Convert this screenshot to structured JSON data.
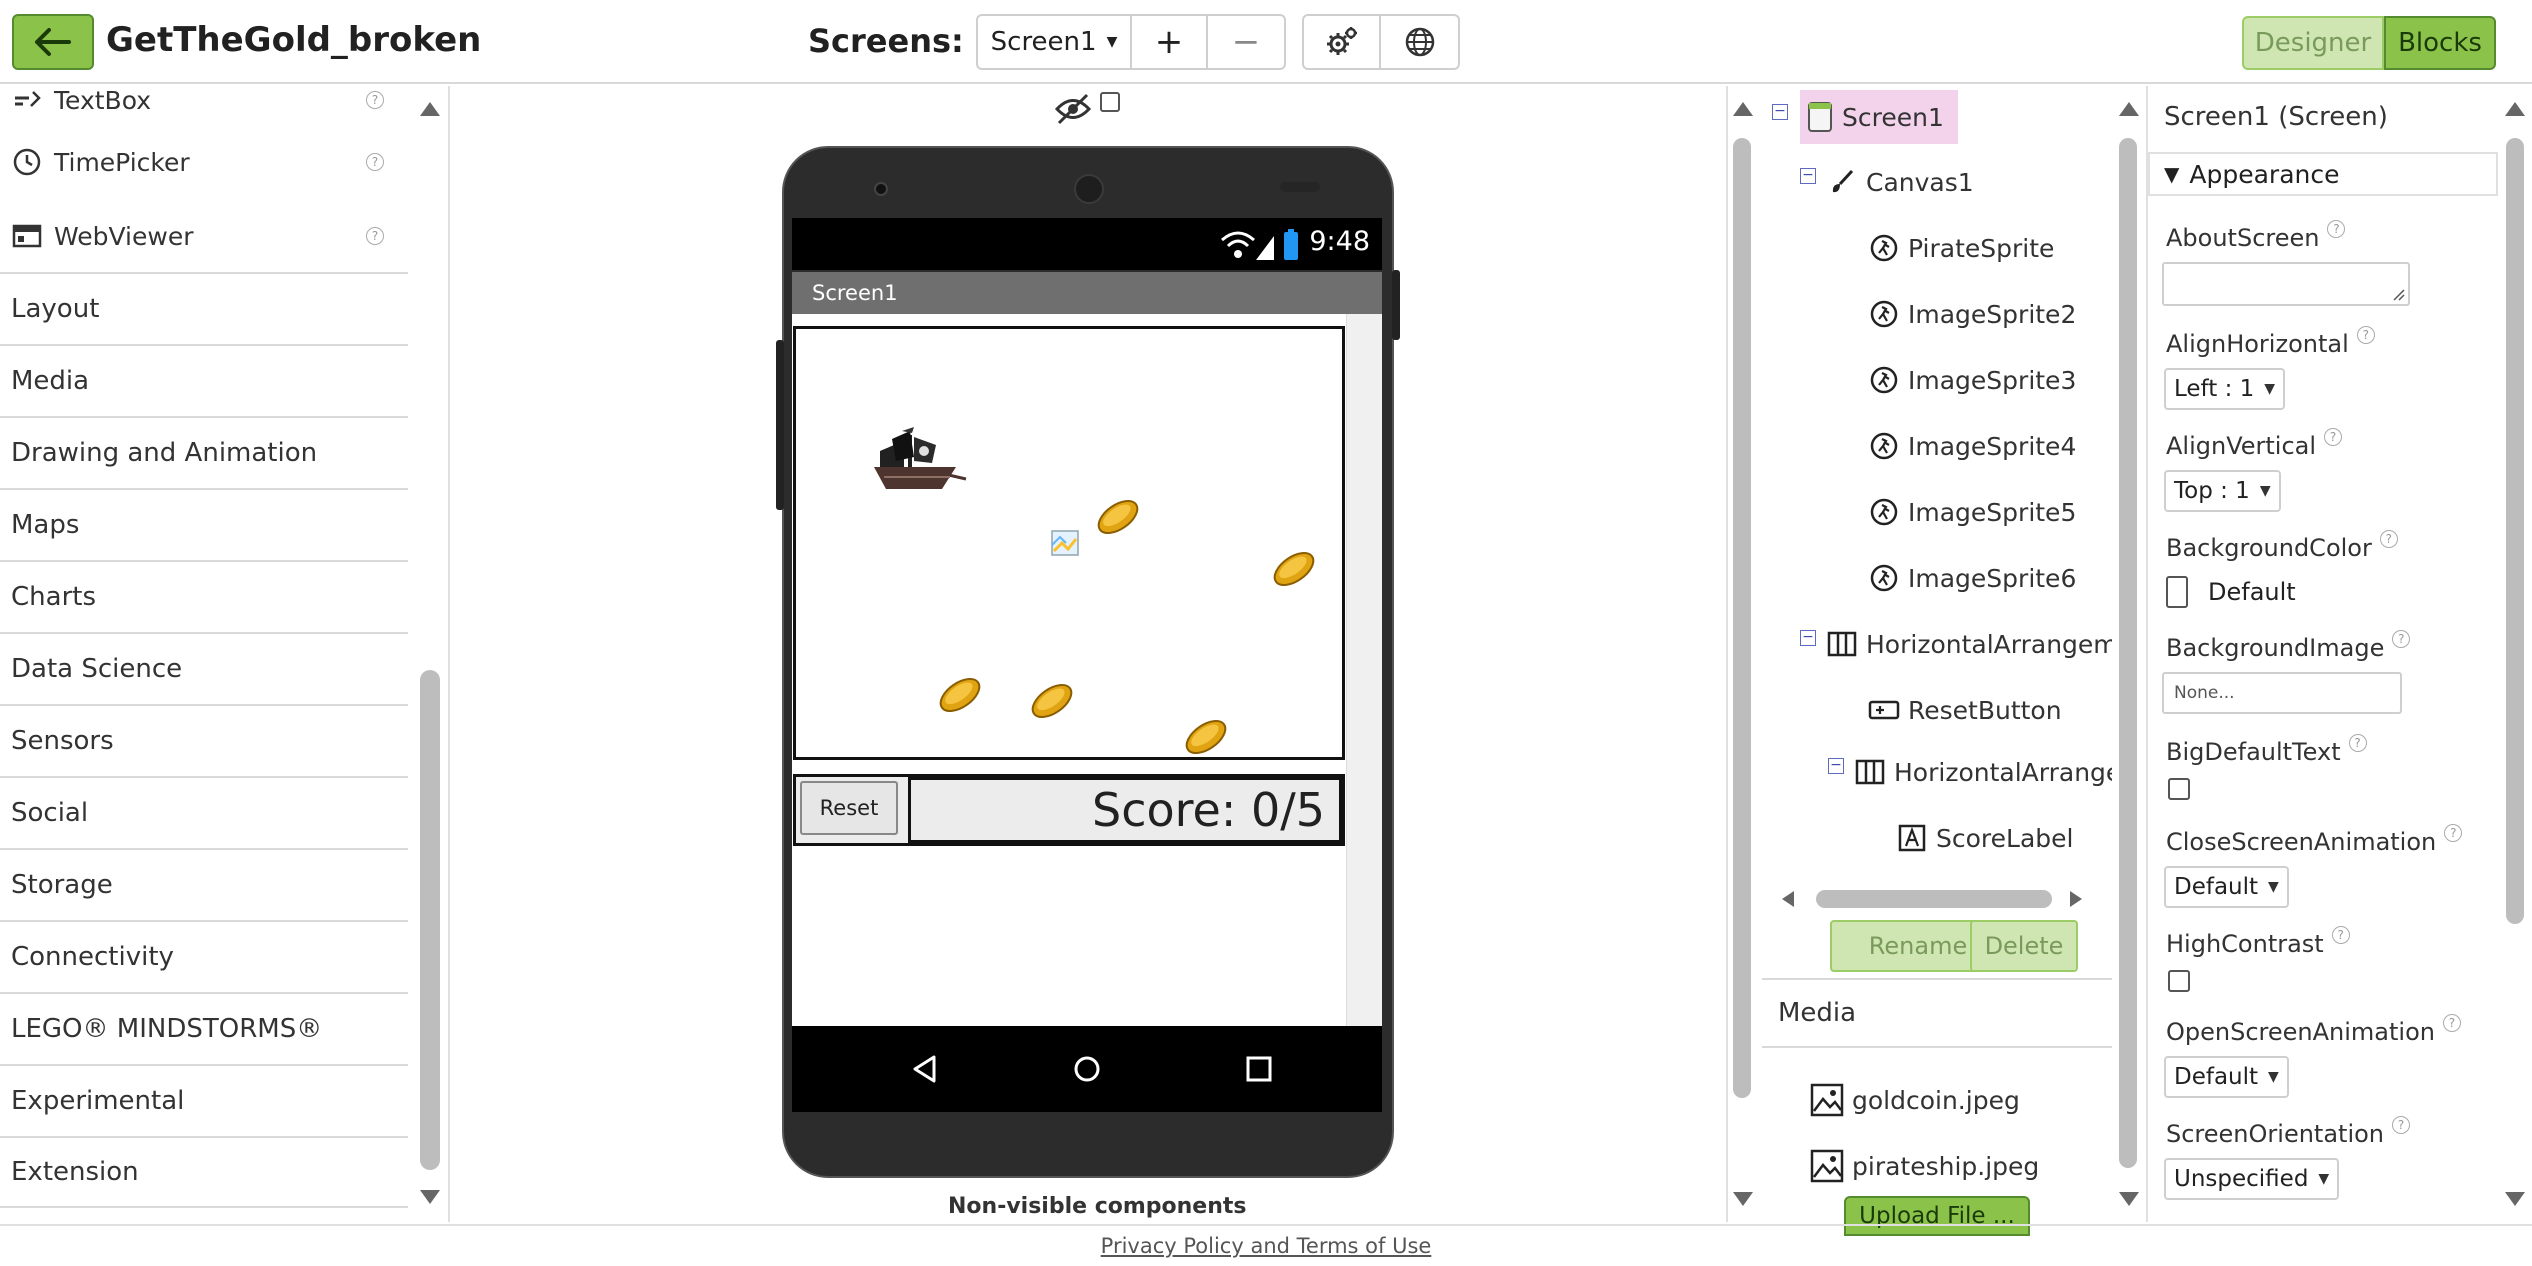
{
  "header": {
    "project_title": "GetTheGold_broken",
    "screens_label": "Screens:",
    "screen_select": "Screen1",
    "add_label": "+",
    "remove_label": "−",
    "designer_label": "Designer",
    "blocks_label": "Blocks"
  },
  "palette": {
    "items": [
      {
        "label": "TextBox",
        "icon": "textbox-icon"
      },
      {
        "label": "TimePicker",
        "icon": "clock-icon"
      },
      {
        "label": "WebViewer",
        "icon": "browser-window-icon"
      }
    ],
    "categories": [
      "Layout",
      "Media",
      "Drawing and Animation",
      "Maps",
      "Charts",
      "Data Science",
      "Sensors",
      "Social",
      "Storage",
      "Connectivity",
      "LEGO® MINDSTORMS®",
      "Experimental",
      "Extension"
    ],
    "help_symbol": "?"
  },
  "viewer": {
    "status_time": "9:48",
    "screen_title": "Screen1",
    "reset_label": "Reset",
    "score_text": "Score: 0/5",
    "nonvisible_label": "Non-visible components"
  },
  "tree": {
    "items": [
      {
        "label": "Screen1",
        "icon": "screen-icon"
      },
      {
        "label": "Canvas1",
        "icon": "paintbrush-icon"
      },
      {
        "label": "PirateSprite",
        "icon": "sprite-icon"
      },
      {
        "label": "ImageSprite2",
        "icon": "sprite-icon"
      },
      {
        "label": "ImageSprite3",
        "icon": "sprite-icon"
      },
      {
        "label": "ImageSprite4",
        "icon": "sprite-icon"
      },
      {
        "label": "ImageSprite5",
        "icon": "sprite-icon"
      },
      {
        "label": "ImageSprite6",
        "icon": "sprite-icon"
      },
      {
        "label": "HorizontalArrangem",
        "icon": "horizontal-arrangement-icon"
      },
      {
        "label": "ResetButton",
        "icon": "button-icon"
      },
      {
        "label": "HorizontalArrange",
        "icon": "horizontal-arrangement-icon"
      },
      {
        "label": "ScoreLabel",
        "icon": "label-icon"
      }
    ],
    "rename_label": "Rename",
    "delete_label": "Delete"
  },
  "media": {
    "title": "Media",
    "files": [
      "goldcoin.jpeg",
      "pirateship.jpeg"
    ],
    "upload_label": "Upload File ..."
  },
  "properties": {
    "title": "Screen1 (Screen)",
    "section": "Appearance",
    "about_screen": "AboutScreen",
    "align_horizontal": "AlignHorizontal",
    "align_horizontal_value": "Left : 1",
    "align_vertical": "AlignVertical",
    "align_vertical_value": "Top : 1",
    "background_color": "BackgroundColor",
    "background_color_value": "Default",
    "background_image": "BackgroundImage",
    "background_image_value": "None...",
    "big_default_text": "BigDefaultText",
    "close_screen_animation": "CloseScreenAnimation",
    "close_screen_animation_value": "Default",
    "high_contrast": "HighContrast",
    "open_screen_animation": "OpenScreenAnimation",
    "open_screen_animation_value": "Default",
    "screen_orientation": "ScreenOrientation",
    "screen_orientation_value": "Unspecified"
  },
  "footer": {
    "link": "Privacy Policy and Terms of Use"
  },
  "colors": {
    "accent_green": "#8bc34a",
    "accent_green_dark": "#558b2f",
    "light_green": "#cfe6b3",
    "selection_pink": "#f3d3ec",
    "gold": "#e0a412"
  }
}
